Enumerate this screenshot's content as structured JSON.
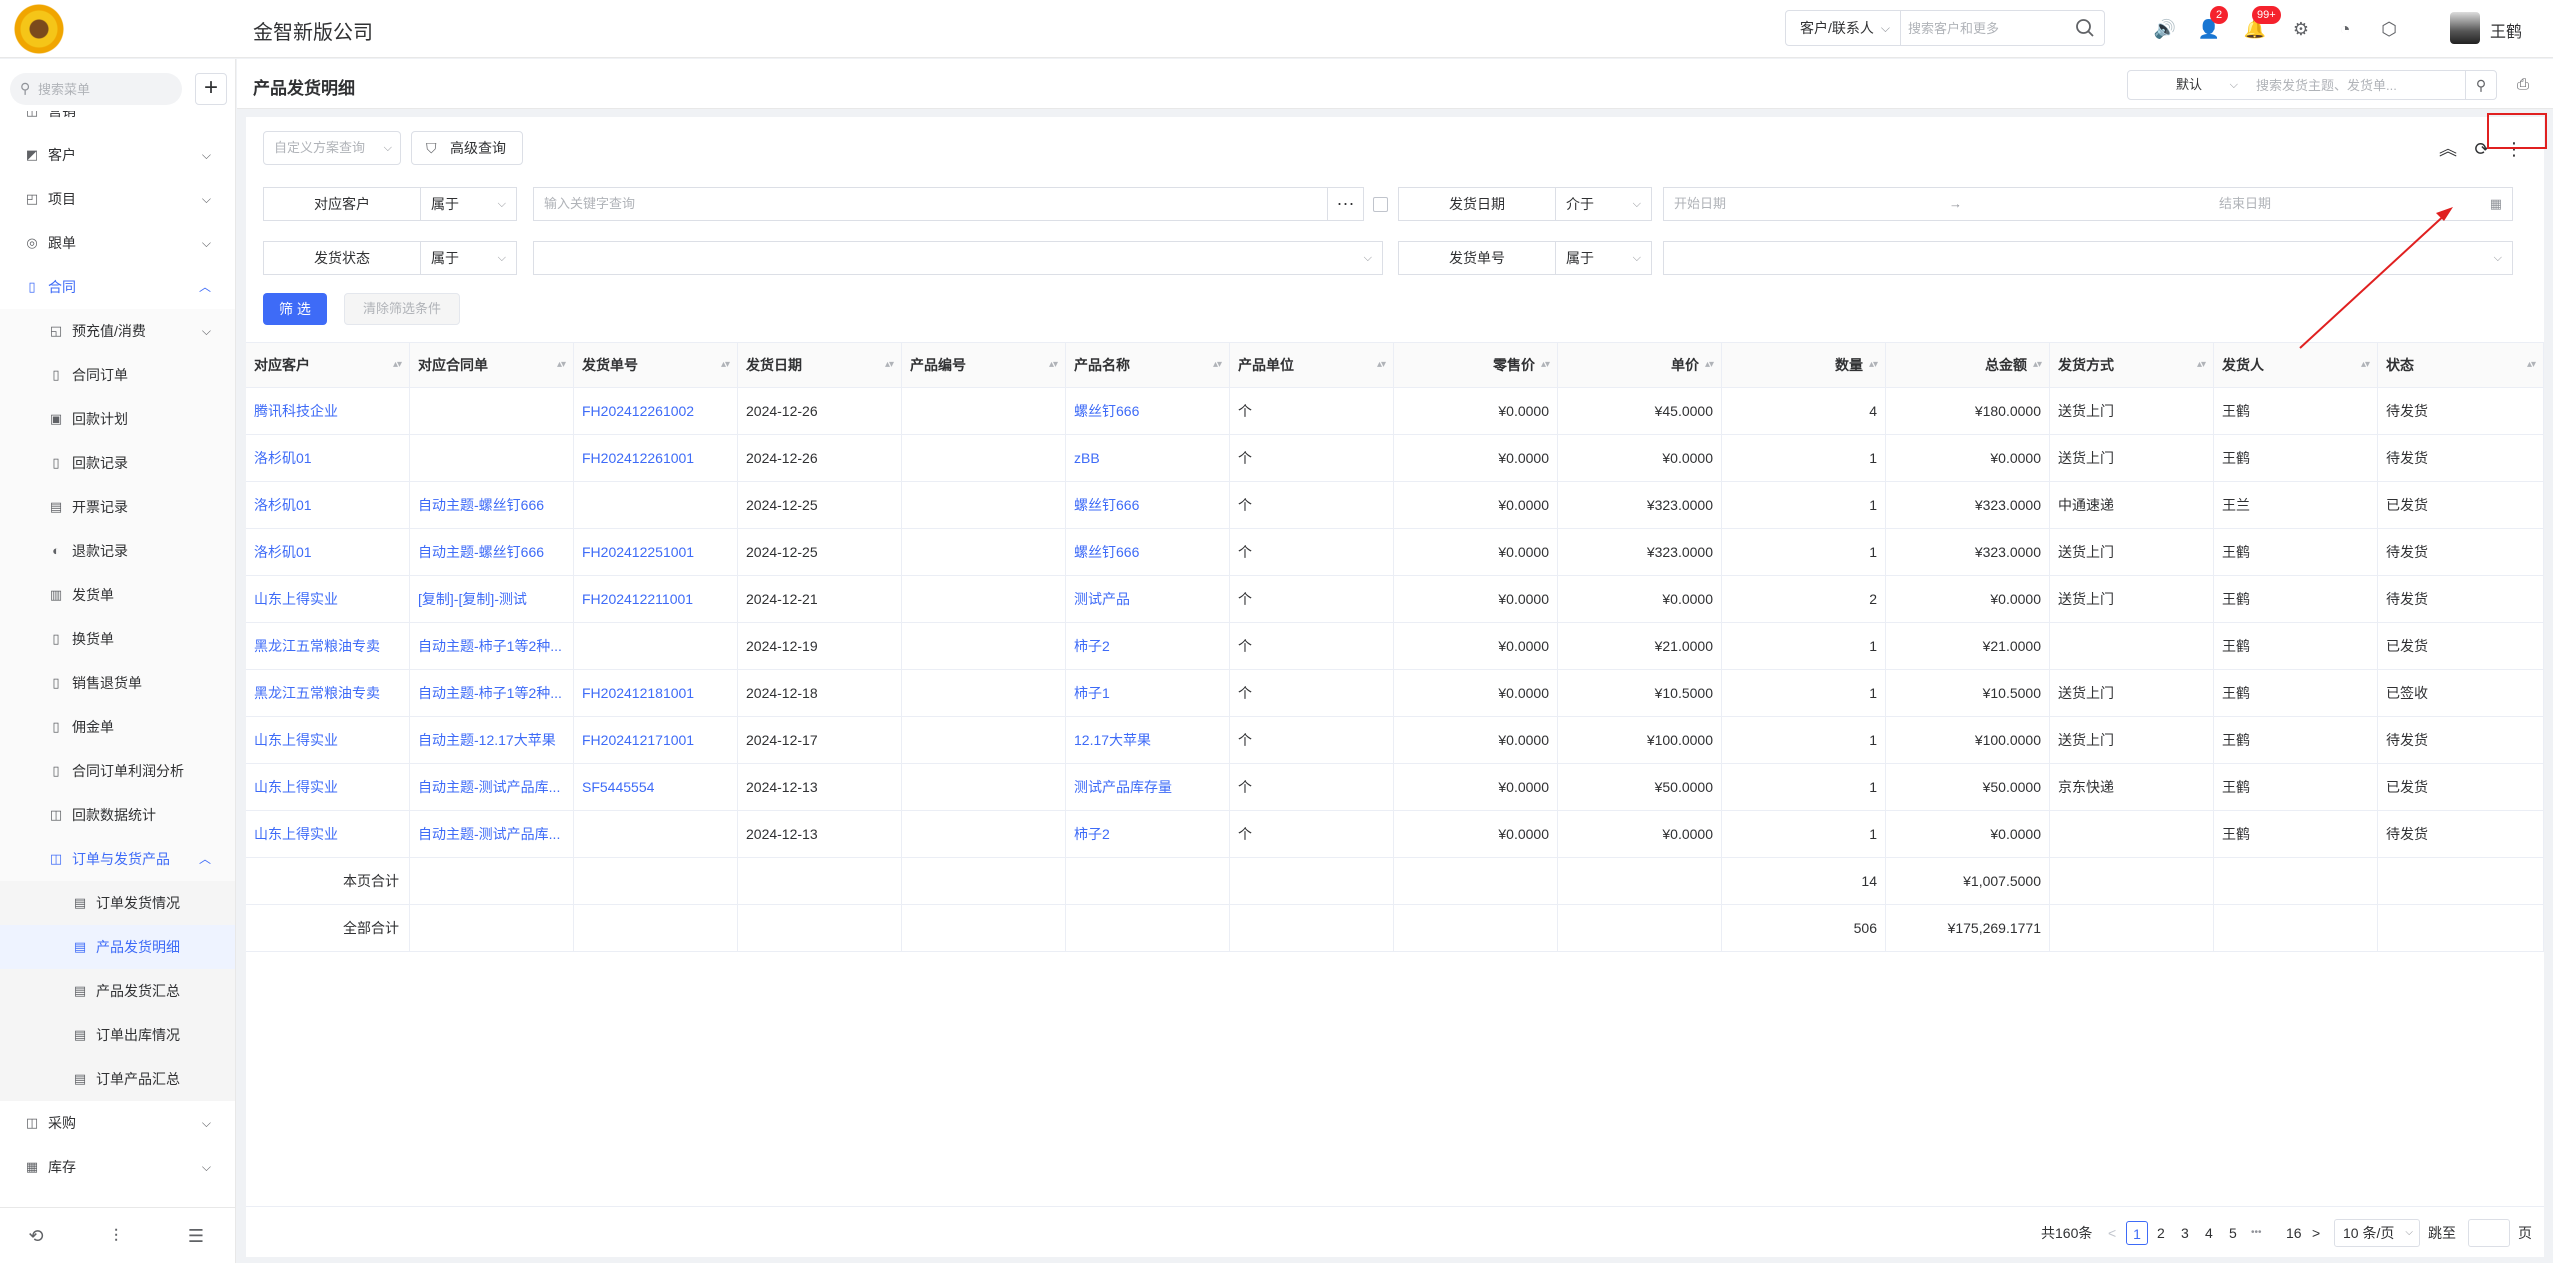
{
  "company": "金智新版公司",
  "global_search": {
    "type_label": "客户/联系人",
    "placeholder": "搜索客户和更多"
  },
  "notifications": {
    "messages_badge": "2",
    "alerts_badge": "99+"
  },
  "user": {
    "name": "王鹤"
  },
  "colors": {
    "accent": "#3e6bf7",
    "badge": "#f5222d",
    "annotation": "#e02020"
  },
  "sidebar": {
    "search_placeholder": "搜索菜单",
    "add_label": "+",
    "cut_item": "营销",
    "items": [
      {
        "label": "客户",
        "icon": "customer-icon"
      },
      {
        "label": "项目",
        "icon": "project-icon"
      },
      {
        "label": "跟单",
        "icon": "follow-icon"
      },
      {
        "label": "合同",
        "icon": "contract-icon"
      },
      {
        "label": "预充值/消费",
        "icon": "recharge-icon"
      },
      {
        "label": "合同订单",
        "icon": "order-icon"
      },
      {
        "label": "回款计划",
        "icon": "plan-icon"
      },
      {
        "label": "回款记录",
        "icon": "record-icon"
      },
      {
        "label": "开票记录",
        "icon": "invoice-icon"
      },
      {
        "label": "退款记录",
        "icon": "refund-icon"
      },
      {
        "label": "发货单",
        "icon": "delivery-icon"
      },
      {
        "label": "换货单",
        "icon": "exchange-icon"
      },
      {
        "label": "销售退货单",
        "icon": "return-icon"
      },
      {
        "label": "佣金单",
        "icon": "commission-icon"
      },
      {
        "label": "合同订单利润分析",
        "icon": "analysis-icon"
      },
      {
        "label": "回款数据统计",
        "icon": "stats-icon"
      },
      {
        "label": "订单与发货产品",
        "icon": "product-icon"
      },
      {
        "label": "订单发货情况",
        "icon": "doc-icon"
      },
      {
        "label": "产品发货明细",
        "icon": "doc-icon"
      },
      {
        "label": "产品发货汇总",
        "icon": "doc-icon"
      },
      {
        "label": "订单出库情况",
        "icon": "doc-icon"
      },
      {
        "label": "订单产品汇总",
        "icon": "doc-icon"
      },
      {
        "label": "采购",
        "icon": "purchase-icon"
      },
      {
        "label": "库存",
        "icon": "stock-icon"
      }
    ]
  },
  "page": {
    "title": "产品发货明细",
    "view_select": "默认",
    "view_search_placeholder": "搜索发货主题、发货单..."
  },
  "filters": {
    "scheme_placeholder": "自定义方案查询",
    "advanced_label": "高级查询",
    "row1": {
      "customer_label": "对应客户",
      "customer_op": "属于",
      "customer_placeholder": "输入关键字查询",
      "date_label": "发货日期",
      "date_op": "介于",
      "date_start": "开始日期",
      "date_sep": "→",
      "date_end": "结束日期"
    },
    "row2": {
      "status_label": "发货状态",
      "status_op": "属于",
      "number_label": "发货单号",
      "number_op": "属于"
    },
    "apply_label": "筛 选",
    "clear_label": "清除筛选条件"
  },
  "table": {
    "headers": [
      "对应客户",
      "对应合同单",
      "发货单号",
      "发货日期",
      "产品编号",
      "产品名称",
      "产品单位",
      "零售价",
      "单价",
      "数量",
      "总金额",
      "发货方式",
      "发货人",
      "状态"
    ],
    "rows": [
      [
        "腾讯科技企业",
        "",
        "FH202412261002",
        "2024-12-26",
        "",
        "螺丝钉666",
        "个",
        "¥0.0000",
        "¥45.0000",
        "4",
        "¥180.0000",
        "送货上门",
        "王鹤",
        "待发货"
      ],
      [
        "洛杉矶01",
        "",
        "FH202412261001",
        "2024-12-26",
        "",
        "zBB",
        "个",
        "¥0.0000",
        "¥0.0000",
        "1",
        "¥0.0000",
        "送货上门",
        "王鹤",
        "待发货"
      ],
      [
        "洛杉矶01",
        "自动主题-螺丝钉666",
        "",
        "2024-12-25",
        "",
        "螺丝钉666",
        "个",
        "¥0.0000",
        "¥323.0000",
        "1",
        "¥323.0000",
        "中通速递",
        "王兰",
        "已发货"
      ],
      [
        "洛杉矶01",
        "自动主题-螺丝钉666",
        "FH202412251001",
        "2024-12-25",
        "",
        "螺丝钉666",
        "个",
        "¥0.0000",
        "¥323.0000",
        "1",
        "¥323.0000",
        "送货上门",
        "王鹤",
        "待发货"
      ],
      [
        "山东上得实业",
        "[复制]-[复制]-测试",
        "FH202412211001",
        "2024-12-21",
        "",
        "测试产品",
        "个",
        "¥0.0000",
        "¥0.0000",
        "2",
        "¥0.0000",
        "送货上门",
        "王鹤",
        "待发货"
      ],
      [
        "黑龙江五常粮油专卖",
        "自动主题-柿子1等2种...",
        "",
        "2024-12-19",
        "",
        "柿子2",
        "个",
        "¥0.0000",
        "¥21.0000",
        "1",
        "¥21.0000",
        "",
        "王鹤",
        "已发货"
      ],
      [
        "黑龙江五常粮油专卖",
        "自动主题-柿子1等2种...",
        "FH202412181001",
        "2024-12-18",
        "",
        "柿子1",
        "个",
        "¥0.0000",
        "¥10.5000",
        "1",
        "¥10.5000",
        "送货上门",
        "王鹤",
        "已签收"
      ],
      [
        "山东上得实业",
        "自动主题-12.17大苹果",
        "FH202412171001",
        "2024-12-17",
        "",
        "12.17大苹果",
        "个",
        "¥0.0000",
        "¥100.0000",
        "1",
        "¥100.0000",
        "送货上门",
        "王鹤",
        "待发货"
      ],
      [
        "山东上得实业",
        "自动主题-测试产品库...",
        "SF5445554",
        "2024-12-13",
        "",
        "测试产品库存量",
        "个",
        "¥0.0000",
        "¥50.0000",
        "1",
        "¥50.0000",
        "京东快递",
        "王鹤",
        "已发货"
      ],
      [
        "山东上得实业",
        "自动主题-测试产品库...",
        "",
        "2024-12-13",
        "",
        "柿子2",
        "个",
        "¥0.0000",
        "¥0.0000",
        "1",
        "¥0.0000",
        "",
        "王鹤",
        "待发货"
      ]
    ],
    "page_total": {
      "label": "本页合计",
      "qty": "14",
      "amount": "¥1,007.5000"
    },
    "grand_total": {
      "label": "全部合计",
      "qty": "506",
      "amount": "¥175,269.1771"
    }
  },
  "pagination": {
    "total": "共160条",
    "prev": "<",
    "pages": [
      "1",
      "2",
      "3",
      "4",
      "5"
    ],
    "ellipsis": "•••",
    "last": "16",
    "next": ">",
    "page_size": "10 条/页",
    "jump_label": "跳至",
    "jump_suffix": "页",
    "current": "1"
  }
}
